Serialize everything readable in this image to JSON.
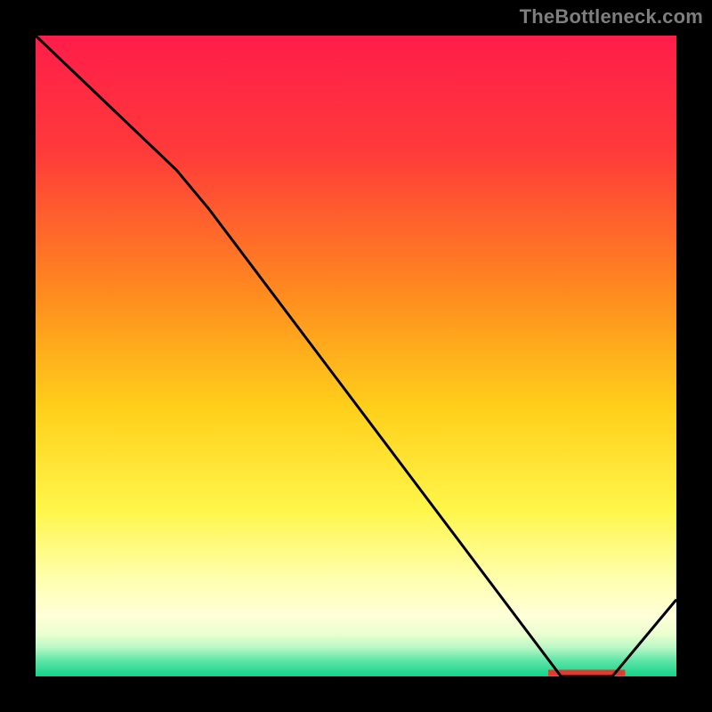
{
  "attribution": "TheBottleneck.com",
  "colors": {
    "frame_bg": "#000000",
    "text": "#7e7e7e",
    "curve": "#000000",
    "red_mark": "#e23a2e",
    "gradient_stops": [
      {
        "offset": 0.0,
        "color": "#ff1d4a"
      },
      {
        "offset": 0.18,
        "color": "#ff3a3a"
      },
      {
        "offset": 0.4,
        "color": "#ff8a1f"
      },
      {
        "offset": 0.58,
        "color": "#ffcf1a"
      },
      {
        "offset": 0.74,
        "color": "#fff64a"
      },
      {
        "offset": 0.85,
        "color": "#ffffb0"
      },
      {
        "offset": 0.905,
        "color": "#ffffd8"
      },
      {
        "offset": 0.935,
        "color": "#e9ffcf"
      },
      {
        "offset": 0.955,
        "color": "#b8f7c6"
      },
      {
        "offset": 0.975,
        "color": "#5fe6a8"
      },
      {
        "offset": 1.0,
        "color": "#13d487"
      }
    ]
  },
  "chart_data": {
    "type": "line",
    "title": "",
    "xlabel": "",
    "ylabel": "",
    "xlim": [
      0,
      100
    ],
    "ylim": [
      0,
      100
    ],
    "series": [
      {
        "name": "bottleneck-curve",
        "points": [
          {
            "x": 0,
            "y": 100
          },
          {
            "x": 22,
            "y": 79
          },
          {
            "x": 27,
            "y": 73
          },
          {
            "x": 82,
            "y": 0
          },
          {
            "x": 90,
            "y": 0
          },
          {
            "x": 100,
            "y": 12
          }
        ]
      }
    ],
    "annotations": [
      {
        "name": "optimum-marker",
        "x_start": 80,
        "x_end": 92,
        "y": 0
      }
    ]
  }
}
